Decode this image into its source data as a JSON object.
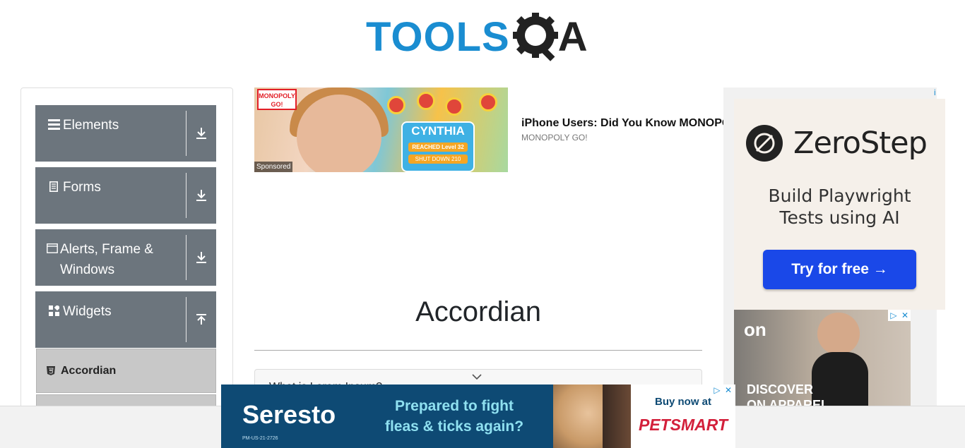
{
  "header": {
    "logo_text": "TOOLS",
    "logo_suffix": "A"
  },
  "sidebar": {
    "groups": [
      {
        "label": "Elements",
        "icon": "hamburger-icon",
        "toggle": "download-arrow"
      },
      {
        "label": "Forms",
        "icon": "document-icon",
        "toggle": "download-arrow"
      },
      {
        "label": "Alerts, Frame & Windows",
        "icon": "window-icon",
        "toggle": "download-arrow"
      },
      {
        "label": "Widgets",
        "icon": "widgets-icon",
        "toggle": "upload-arrow"
      }
    ],
    "active_item": {
      "label": "Accordian",
      "icon": "html5-icon"
    }
  },
  "ad_top": {
    "sponsored": "Sponsored",
    "title": "iPhone Users: Did You Know MONOPOLY GO!",
    "source": "MONOPOLY GO!",
    "brand_badge": "MONOPOLY GO!",
    "card_name": "CYNTHIA",
    "card_level": "REACHED Level 32",
    "card_sub": "SHUT DOWN 210"
  },
  "main": {
    "title": "Accordian",
    "section_heading": "What is Lorem Ipsum?"
  },
  "side_ad": {
    "brand": "ZeroStep",
    "tagline_line1": "Build Playwright",
    "tagline_line2": "Tests using AI",
    "cta": "Try for free →",
    "info": "i"
  },
  "side_ad2": {
    "brand": "on",
    "headline_line1": "DISCOVER",
    "headline_line2": "ON APPAREL"
  },
  "bottom_ad": {
    "brand": "Seresto",
    "code": "PM-US-21-2726",
    "tagline_line1": "Prepared to fight",
    "tagline_line2": "fleas & ticks again?",
    "cta": "Buy now at",
    "retailer": "PETSMART"
  },
  "colors": {
    "brand_blue": "#1a8dd1",
    "sidebar_group": "#6c757d",
    "cta_blue": "#1a48e8"
  }
}
